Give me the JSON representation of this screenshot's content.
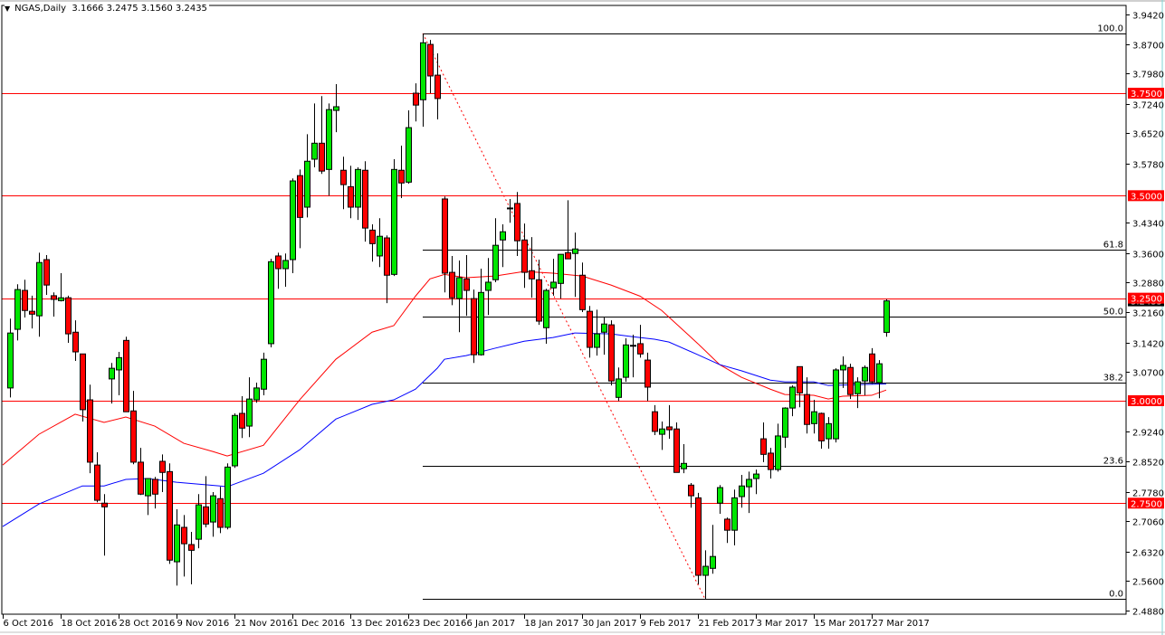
{
  "header": {
    "symbol_timeframe": "NGAS,Daily",
    "ohlc": "3.1666 3.2475 3.1560 3.2435",
    "menu_icon": "triangle-down"
  },
  "colors": {
    "bull": "#00e600",
    "bear": "#ff0000",
    "ma_fast": "#ff0000",
    "ma_slow": "#0000ff",
    "level": "#ff0000",
    "fib": "#000000",
    "trend": "#ff0000",
    "price_label_bg": "#ff0000",
    "current_label_bg": "#000000"
  },
  "chart_data": {
    "type": "candlestick",
    "title": "NGAS,Daily",
    "ylim": [
      2.488,
      3.942
    ],
    "y_ticks": [
      "3.9420",
      "3.8700",
      "3.7980",
      "3.7240",
      "3.6520",
      "3.5780",
      "3.4340",
      "3.3600",
      "3.2880",
      "3.2160",
      "3.1420",
      "3.0700",
      "2.9240",
      "2.8520",
      "2.7780",
      "2.7060",
      "2.6320",
      "2.5600",
      "2.4880"
    ],
    "x_labels": [
      "6 Oct 2016",
      "18 Oct 2016",
      "28 Oct 2016",
      "9 Nov 2016",
      "21 Nov 2016",
      "1 Dec 2016",
      "13 Dec 2016",
      "23 Dec 2016",
      "6 Jan 2017",
      "18 Jan 2017",
      "30 Jan 2017",
      "9 Feb 2017",
      "21 Feb 2017",
      "3 Mar 2017",
      "15 Mar 2017",
      "27 Mar 2017"
    ],
    "x_label_every_n_bars": 8,
    "ohlc": [
      [
        3.031,
        3.2,
        3.008,
        3.165
      ],
      [
        3.174,
        3.284,
        3.147,
        3.271
      ],
      [
        3.269,
        3.295,
        3.203,
        3.22
      ],
      [
        3.218,
        3.256,
        3.176,
        3.211
      ],
      [
        3.207,
        3.361,
        3.156,
        3.337
      ],
      [
        3.344,
        3.355,
        3.258,
        3.282
      ],
      [
        3.256,
        3.264,
        3.205,
        3.247
      ],
      [
        3.244,
        3.311,
        3.242,
        3.251
      ],
      [
        3.251,
        3.256,
        3.141,
        3.163
      ],
      [
        3.167,
        3.196,
        3.097,
        3.119
      ],
      [
        3.114,
        3.114,
        2.949,
        2.978
      ],
      [
        3.002,
        3.039,
        2.823,
        2.85
      ],
      [
        2.843,
        2.874,
        2.752,
        2.757
      ],
      [
        2.75,
        2.772,
        2.622,
        2.741
      ],
      [
        3.053,
        3.092,
        2.993,
        3.079
      ],
      [
        3.075,
        3.119,
        3.013,
        3.105
      ],
      [
        3.147,
        3.156,
        2.973,
        2.973
      ],
      [
        2.975,
        3.024,
        2.845,
        2.85
      ],
      [
        2.85,
        2.885,
        2.77,
        2.772
      ],
      [
        2.768,
        2.81,
        2.721,
        2.81
      ],
      [
        2.808,
        2.814,
        2.737,
        2.772
      ],
      [
        2.852,
        2.869,
        2.777,
        2.825
      ],
      [
        2.827,
        2.847,
        2.602,
        2.611
      ],
      [
        2.607,
        2.735,
        2.549,
        2.697
      ],
      [
        2.691,
        2.721,
        2.571,
        2.651
      ],
      [
        2.649,
        2.68,
        2.552,
        2.635
      ],
      [
        2.662,
        2.772,
        2.64,
        2.746
      ],
      [
        2.741,
        2.816,
        2.691,
        2.699
      ],
      [
        2.704,
        2.777,
        2.668,
        2.768
      ],
      [
        2.761,
        2.79,
        2.677,
        2.691
      ],
      [
        2.691,
        2.847,
        2.686,
        2.838
      ],
      [
        2.841,
        2.969,
        2.836,
        2.964
      ],
      [
        2.969,
        3.011,
        2.909,
        2.933
      ],
      [
        2.938,
        3.057,
        2.911,
        3.004
      ],
      [
        3.002,
        3.044,
        2.995,
        3.031
      ],
      [
        3.028,
        3.117,
        3.013,
        3.101
      ],
      [
        3.139,
        3.346,
        3.13,
        3.339
      ],
      [
        3.353,
        3.361,
        3.273,
        3.322
      ],
      [
        3.322,
        3.359,
        3.278,
        3.342
      ],
      [
        3.344,
        3.542,
        3.311,
        3.536
      ],
      [
        3.549,
        3.564,
        3.372,
        3.447
      ],
      [
        3.472,
        3.65,
        3.447,
        3.584
      ],
      [
        3.589,
        3.725,
        3.569,
        3.628
      ],
      [
        3.628,
        3.743,
        3.553,
        3.56
      ],
      [
        3.564,
        3.725,
        3.5,
        3.71
      ],
      [
        3.708,
        3.772,
        3.655,
        3.717
      ],
      [
        3.562,
        3.595,
        3.467,
        3.527
      ],
      [
        3.522,
        3.573,
        3.445,
        3.472
      ],
      [
        3.472,
        3.569,
        3.441,
        3.564
      ],
      [
        3.562,
        3.584,
        3.388,
        3.421
      ],
      [
        3.416,
        3.43,
        3.339,
        3.383
      ],
      [
        3.353,
        3.445,
        3.326,
        3.401
      ],
      [
        3.397,
        3.403,
        3.238,
        3.306
      ],
      [
        3.308,
        3.589,
        3.304,
        3.564
      ],
      [
        3.562,
        3.622,
        3.494,
        3.531
      ],
      [
        3.533,
        3.708,
        3.529,
        3.666
      ],
      [
        3.75,
        3.774,
        3.681,
        3.721
      ],
      [
        3.734,
        3.895,
        3.668,
        3.873
      ],
      [
        3.869,
        3.88,
        3.75,
        3.792
      ],
      [
        3.794,
        3.847,
        3.686,
        3.737
      ],
      [
        3.492,
        3.498,
        3.264,
        3.311
      ],
      [
        3.313,
        3.353,
        3.233,
        3.251
      ],
      [
        3.249,
        3.342,
        3.167,
        3.3
      ],
      [
        3.297,
        3.355,
        3.207,
        3.269
      ],
      [
        3.249,
        3.271,
        3.092,
        3.112
      ],
      [
        3.112,
        3.322,
        3.11,
        3.264
      ],
      [
        3.269,
        3.348,
        3.209,
        3.289
      ],
      [
        3.295,
        3.445,
        3.289,
        3.379
      ],
      [
        3.392,
        3.43,
        3.326,
        3.412
      ],
      [
        3.469,
        3.492,
        3.434,
        3.47
      ],
      [
        3.481,
        3.509,
        3.353,
        3.39
      ],
      [
        3.392,
        3.432,
        3.275,
        3.313
      ],
      [
        3.317,
        3.399,
        3.251,
        3.297
      ],
      [
        3.295,
        3.344,
        3.185,
        3.194
      ],
      [
        3.178,
        3.273,
        3.139,
        3.269
      ],
      [
        3.275,
        3.346,
        3.256,
        3.289
      ],
      [
        3.286,
        3.357,
        3.249,
        3.357
      ],
      [
        3.361,
        3.489,
        3.346,
        3.346
      ],
      [
        3.359,
        3.41,
        3.253,
        3.37
      ],
      [
        3.306,
        3.337,
        3.216,
        3.222
      ],
      [
        3.218,
        3.231,
        3.105,
        3.13
      ],
      [
        3.13,
        3.222,
        3.11,
        3.163
      ],
      [
        3.167,
        3.205,
        3.112,
        3.187
      ],
      [
        3.185,
        3.196,
        3.037,
        3.048
      ],
      [
        3.008,
        3.081,
        2.999,
        3.053
      ],
      [
        3.057,
        3.152,
        3.046,
        3.136
      ],
      [
        3.133,
        3.161,
        3.057,
        3.135
      ],
      [
        3.139,
        3.185,
        3.105,
        3.114
      ],
      [
        3.099,
        3.117,
        2.999,
        3.033
      ],
      [
        2.973,
        2.989,
        2.916,
        2.925
      ],
      [
        2.918,
        2.949,
        2.88,
        2.931
      ],
      [
        2.936,
        2.989,
        2.907,
        2.929
      ],
      [
        2.931,
        2.947,
        2.825,
        2.825
      ],
      [
        2.834,
        2.894,
        2.823,
        2.847
      ],
      [
        2.794,
        2.799,
        2.739,
        2.768
      ],
      [
        2.763,
        2.775,
        2.552,
        2.574
      ],
      [
        2.574,
        2.635,
        2.516,
        2.596
      ],
      [
        2.591,
        2.697,
        2.578,
        2.62
      ],
      [
        2.75,
        2.794,
        2.724,
        2.788
      ],
      [
        2.711,
        2.715,
        2.653,
        2.684
      ],
      [
        2.684,
        2.783,
        2.647,
        2.763
      ],
      [
        2.766,
        2.819,
        2.739,
        2.792
      ],
      [
        2.79,
        2.827,
        2.726,
        2.808
      ],
      [
        2.81,
        2.832,
        2.772,
        2.821
      ],
      [
        2.907,
        2.947,
        2.85,
        2.869
      ],
      [
        2.872,
        2.885,
        2.81,
        2.832
      ],
      [
        2.832,
        2.944,
        2.827,
        2.914
      ],
      [
        2.911,
        2.984,
        2.885,
        2.982
      ],
      [
        2.982,
        3.037,
        2.962,
        3.033
      ],
      [
        3.083,
        3.083,
        2.984,
        3.019
      ],
      [
        3.015,
        3.057,
        2.92,
        2.942
      ],
      [
        2.944,
        3.002,
        2.92,
        2.973
      ],
      [
        2.969,
        2.971,
        2.883,
        2.902
      ],
      [
        2.907,
        2.96,
        2.883,
        2.944
      ],
      [
        2.907,
        3.079,
        2.898,
        3.075
      ],
      [
        3.075,
        3.108,
        3.031,
        3.086
      ],
      [
        3.081,
        3.09,
        3.004,
        3.015
      ],
      [
        3.017,
        3.057,
        2.982,
        3.046
      ],
      [
        3.048,
        3.086,
        3.013,
        3.081
      ],
      [
        3.114,
        3.128,
        3.041,
        3.046
      ],
      [
        3.044,
        3.099,
        3.006,
        3.09
      ],
      [
        3.1666,
        3.2475,
        3.156,
        3.2435
      ]
    ],
    "ma_fast": [
      [
        0,
        2.843
      ],
      [
        5,
        2.918
      ],
      [
        10,
        2.967
      ],
      [
        14,
        2.947
      ],
      [
        17,
        2.96
      ],
      [
        21,
        2.938
      ],
      [
        25,
        2.896
      ],
      [
        29,
        2.876
      ],
      [
        31,
        2.865
      ],
      [
        36,
        2.891
      ],
      [
        41,
        3.002
      ],
      [
        46,
        3.101
      ],
      [
        51,
        3.167
      ],
      [
        54,
        3.183
      ],
      [
        57,
        3.255
      ],
      [
        59,
        3.297
      ],
      [
        61,
        3.308
      ],
      [
        64,
        3.3
      ],
      [
        68,
        3.304
      ],
      [
        72,
        3.315
      ],
      [
        76,
        3.311
      ],
      [
        80,
        3.304
      ],
      [
        84,
        3.282
      ],
      [
        88,
        3.255
      ],
      [
        91,
        3.22
      ],
      [
        96,
        3.139
      ],
      [
        99,
        3.088
      ],
      [
        102,
        3.057
      ],
      [
        106,
        3.028
      ],
      [
        108,
        3.015
      ],
      [
        112,
        3.013
      ],
      [
        114,
        3.004
      ],
      [
        116,
        3.011
      ],
      [
        120,
        3.013
      ],
      [
        122,
        3.026
      ]
    ],
    "ma_slow": [
      [
        0,
        2.693
      ],
      [
        5,
        2.748
      ],
      [
        11,
        2.792
      ],
      [
        14,
        2.792
      ],
      [
        17,
        2.808
      ],
      [
        20,
        2.81
      ],
      [
        24,
        2.801
      ],
      [
        30,
        2.792
      ],
      [
        31,
        2.79
      ],
      [
        36,
        2.823
      ],
      [
        41,
        2.88
      ],
      [
        46,
        2.955
      ],
      [
        51,
        2.991
      ],
      [
        54,
        3.002
      ],
      [
        57,
        3.028
      ],
      [
        60,
        3.079
      ],
      [
        61,
        3.101
      ],
      [
        64,
        3.11
      ],
      [
        68,
        3.128
      ],
      [
        72,
        3.145
      ],
      [
        76,
        3.154
      ],
      [
        79,
        3.165
      ],
      [
        84,
        3.163
      ],
      [
        87,
        3.156
      ],
      [
        90,
        3.15
      ],
      [
        92,
        3.143
      ],
      [
        96,
        3.112
      ],
      [
        99,
        3.088
      ],
      [
        102,
        3.073
      ],
      [
        106,
        3.05
      ],
      [
        108,
        3.046
      ],
      [
        112,
        3.046
      ],
      [
        114,
        3.037
      ],
      [
        118,
        3.039
      ],
      [
        122,
        3.041
      ]
    ],
    "horizontal_levels": [
      {
        "price": 3.75,
        "label": "3.7500"
      },
      {
        "price": 3.5,
        "label": "3.5000"
      },
      {
        "price": 3.25,
        "label": "3.2500"
      },
      {
        "price": 3.0,
        "label": "3.0000"
      },
      {
        "price": 2.75,
        "label": "2.7500"
      }
    ],
    "current_price": {
      "price": 3.2435,
      "label": "3.2435"
    },
    "fibonacci": {
      "from_bar": 58,
      "high": 3.896,
      "to_bar": 97,
      "low": 2.516,
      "levels": [
        {
          "ratio": 1.0,
          "label": "100.0"
        },
        {
          "ratio": 0.618,
          "label": "61.8"
        },
        {
          "ratio": 0.5,
          "label": "50.0"
        },
        {
          "ratio": 0.382,
          "label": "38.2"
        },
        {
          "ratio": 0.236,
          "label": "23.6"
        },
        {
          "ratio": 0.0,
          "label": "0.0"
        }
      ]
    }
  }
}
